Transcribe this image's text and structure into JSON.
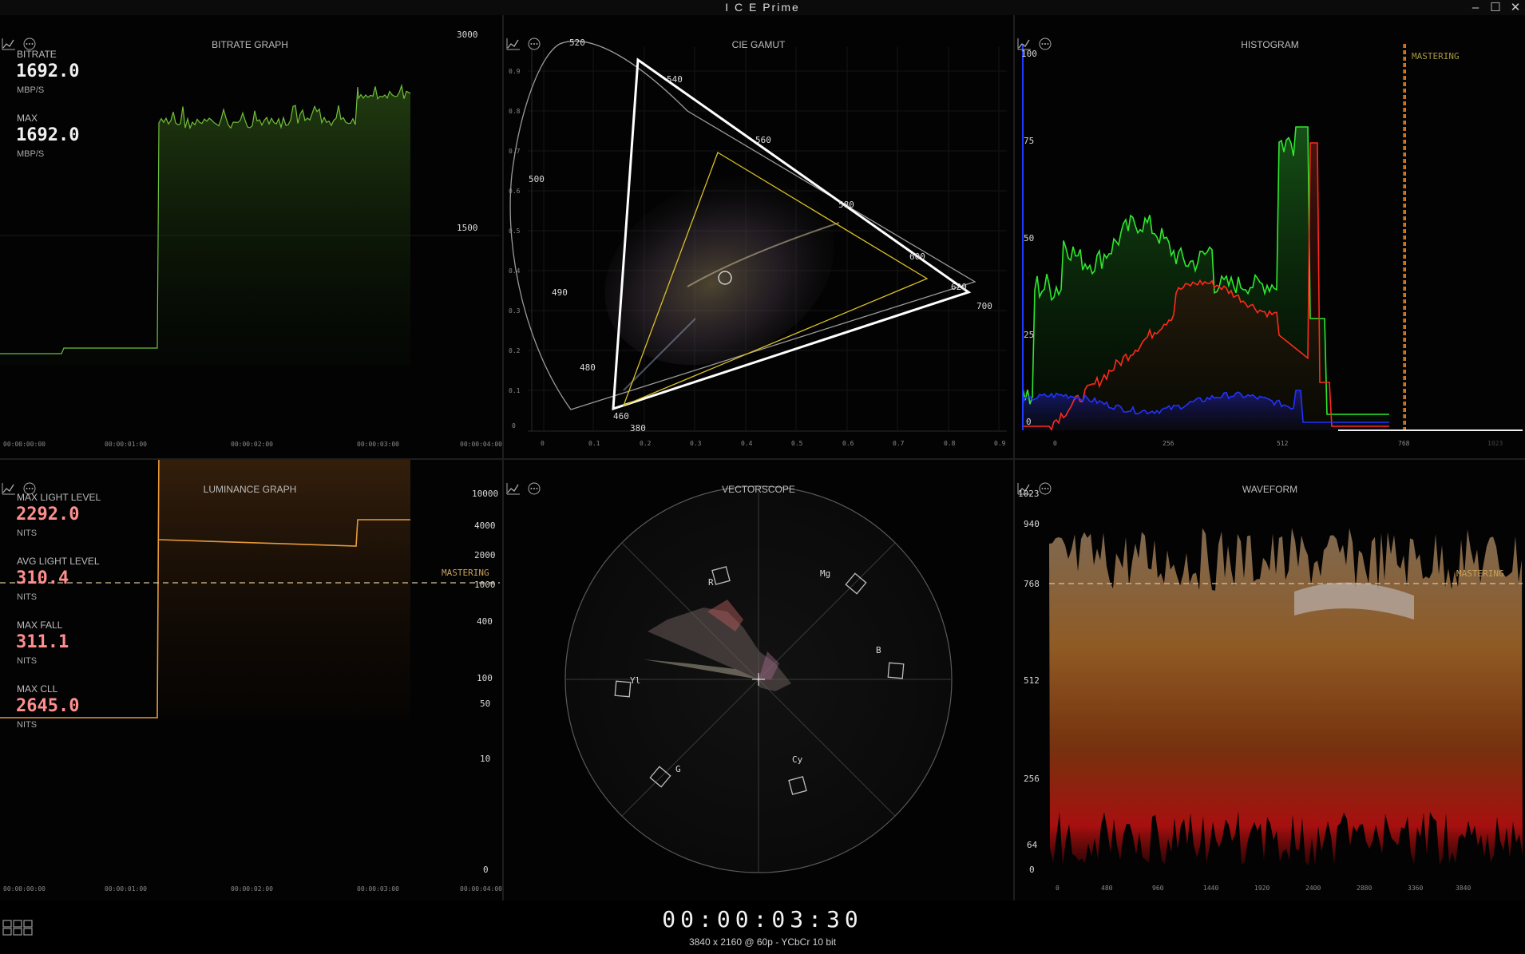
{
  "window": {
    "title": "I C E Prime",
    "controls": [
      "–",
      "☐",
      "✕"
    ]
  },
  "panels": {
    "bitrate": {
      "title": "BITRATE GRAPH",
      "bitrate_label": "BITRATE",
      "bitrate_value": "1692.0",
      "bitrate_unit": "MBP/S",
      "max_label": "MAX",
      "max_value": "1692.0",
      "max_unit": "MBP/S",
      "y_ticks": [
        "3000",
        "1500"
      ],
      "x_ticks": [
        "00:00:00:00",
        "00:00:01:00",
        "00:00:02:00",
        "00:00:03:00",
        "00:00:04:00"
      ],
      "line_color": "#6fbf3a"
    },
    "cie": {
      "title": "CIE GAMUT",
      "wavelengths": [
        "520",
        "540",
        "560",
        "580",
        "600",
        "620",
        "700",
        "500",
        "490",
        "480",
        "460",
        "380"
      ],
      "x_ticks": [
        "0",
        "0.1",
        "0.2",
        "0.3",
        "0.4",
        "0.5",
        "0.6",
        "0.7",
        "0.8",
        "0.9"
      ],
      "y_ticks": [
        "0.9",
        "0.8",
        "0.7",
        "0.6",
        "0.5",
        "0.4",
        "0.3",
        "0.2",
        "0.1",
        "0"
      ]
    },
    "histogram": {
      "title": "HISTOGRAM",
      "y_ticks": [
        "100",
        "75",
        "50",
        "25",
        "0"
      ],
      "x_ticks": [
        "0",
        "256",
        "512",
        "768",
        "1023"
      ],
      "mastering": "MASTERING"
    },
    "luminance": {
      "title": "LUMINANCE GRAPH",
      "max_light_label": "MAX LIGHT LEVEL",
      "max_light_value": "2292.0",
      "max_light_unit": "NITS",
      "avg_light_label": "AVG LIGHT LEVEL",
      "avg_light_value": "310.4",
      "avg_light_unit": "NITS",
      "max_fall_label": "MAX FALL",
      "max_fall_value": "311.1",
      "max_fall_unit": "NITS",
      "max_cll_label": "MAX CLL",
      "max_cll_value": "2645.0",
      "max_cll_unit": "NITS",
      "y_ticks": [
        "10000",
        "4000",
        "2000",
        "1000",
        "400",
        "100",
        "50",
        "10",
        "0"
      ],
      "x_ticks": [
        "00:00:00:00",
        "00:00:01:00",
        "00:00:02:00",
        "00:00:03:00",
        "00:00:04:00"
      ],
      "mastering": "MASTERING",
      "line_color": "#e89a3a"
    },
    "vectorscope": {
      "title": "VECTORSCOPE",
      "targets": [
        "R",
        "Mg",
        "B",
        "Cy",
        "G",
        "Yl"
      ]
    },
    "waveform": {
      "title": "WAVEFORM",
      "y_ticks": [
        "1023",
        "940",
        "768",
        "512",
        "256",
        "64",
        "0"
      ],
      "x_ticks": [
        "0",
        "480",
        "960",
        "1440",
        "1920",
        "2400",
        "2880",
        "3360",
        "3840"
      ],
      "mastering": "MASTERING"
    }
  },
  "footer": {
    "timecode": "00:00:03:30",
    "format": "3840 x 2160 @ 60p - YCbCr 10 bit"
  }
}
